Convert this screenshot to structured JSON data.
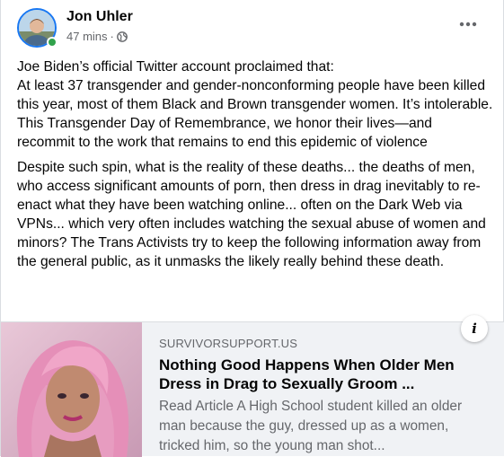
{
  "post": {
    "author": "Jon Uhler",
    "timestamp": "47 mins",
    "separator": "·",
    "privacy_icon": "globe-icon",
    "more_icon": "more-dots-icon",
    "paragraphs": [
      "Joe Biden’s official Twitter account proclaimed that:\nAt least 37 transgender and gender-nonconforming people have been killed this year, most of them Black and Brown transgender women. It’s intolerable. This Transgender Day of Remembrance, we honor their lives—and recommit to the work that remains to end this epidemic of violence",
      "Despite such spin, what is the reality of these deaths... the deaths of men, who access significant amounts of porn, then dress in drag inevitably to re-enact what they have been watching online... often on the Dark Web via VPNs... which very often includes watching the sexual abuse of women and minors?  The Trans Activists try to keep the following information away from the general public, as it unmasks the likely really behind these death."
    ]
  },
  "link_preview": {
    "domain": "SURVIVORSUPPORT.US",
    "title": "Nothing Good Happens When Older Men Dress in Drag to Sexually Groom ...",
    "description": "Read Article A High School student killed an older man because the guy, dressed up as a women, tricked him, so the young man shot...",
    "info_label": "i"
  },
  "colors": {
    "online": "#31a24c",
    "avatar_ring": "#1877f2",
    "secondary_text": "#65676b",
    "card_bg": "#f0f2f5"
  }
}
